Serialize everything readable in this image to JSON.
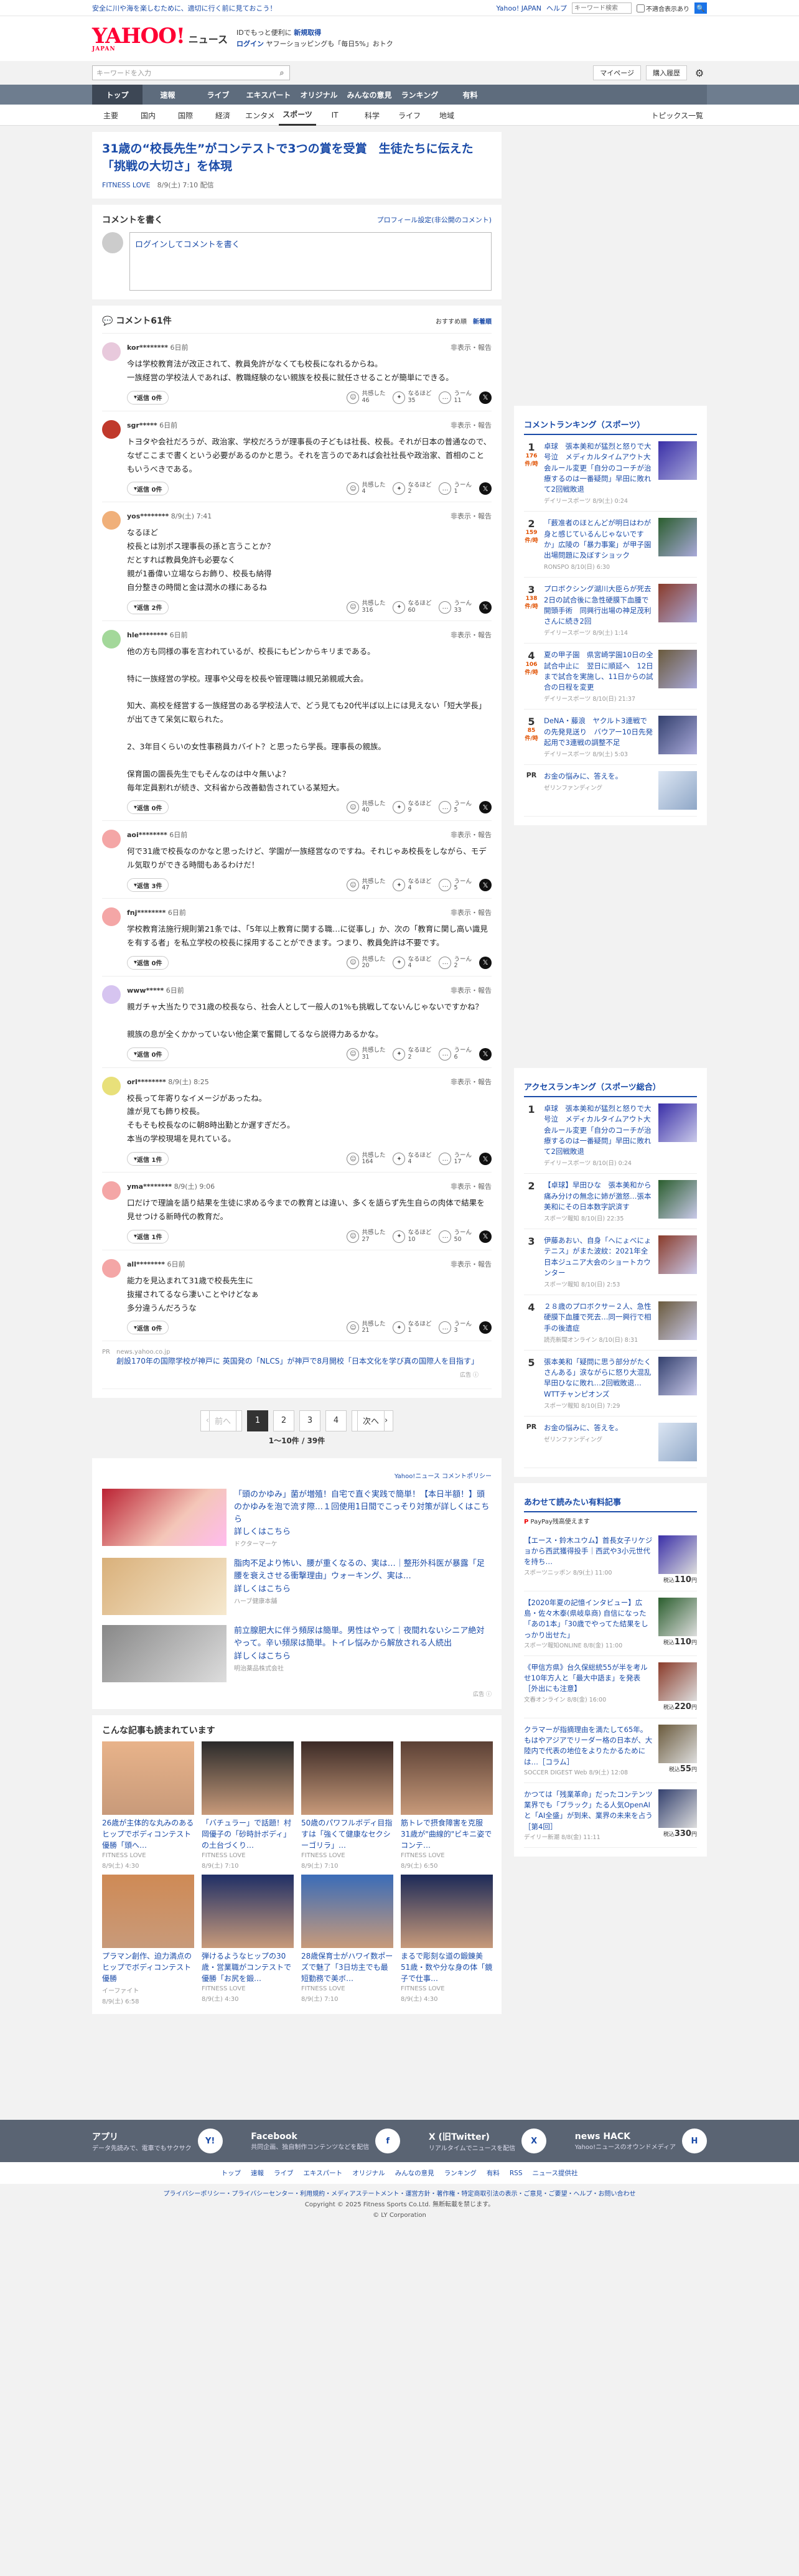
{
  "top": {
    "promo": "安全に川や海を楽しむために、適切に行く前に見ておこう！",
    "links": [
      "Yahoo! JAPAN",
      "ヘルプ"
    ],
    "search_placeholder": "キーワード検索",
    "check_label": "不適合表示あり",
    "search_btn": "🔍"
  },
  "header": {
    "logo": "YAHOO!",
    "logo_sub": "JAPAN",
    "service": "ニュース",
    "promo1": "IDでもっと便利に",
    "promo1b": "新規取得",
    "promo2a": "ログイン",
    "promo2b": "ヤフーショッピングも「毎日5%」おトク"
  },
  "searchrow": {
    "placeholder": "キーワードを入力",
    "mypage": "マイページ",
    "subscribe": "購入履歴"
  },
  "mainnav": [
    "トップ",
    "速報",
    "ライブ",
    "エキスパート",
    "オリジナル",
    "みんなの意見",
    "ランキング",
    "有料"
  ],
  "subnav": [
    "主要",
    "国内",
    "国際",
    "経済",
    "エンタメ",
    "スポーツ",
    "IT",
    "科学",
    "ライフ",
    "地域"
  ],
  "subnav_right": "トピックス一覧",
  "article": {
    "title": "31歳の“校長先生”がコンテストで3つの賞を受賞　生徒たちに伝えた「挑戦の大切さ」を体現",
    "source": "FITNESS LOVE",
    "date": "8/9(土) 7:10 配信"
  },
  "comment_form": {
    "title": "コメントを書く",
    "settings": "プロフィール設定(非公開のコメント)",
    "placeholder": "ログインしてコメントを書く"
  },
  "comments_header": {
    "title": "コメント61件",
    "sort1": "おすすめ順",
    "sort2": "新着順"
  },
  "comments": [
    {
      "user": "kor********",
      "time": "6日前",
      "text": "今は学校教育法が改正されて、教員免許がなくても校長になれるからね。\n一族経営の学校法人であれば、教職経験のない親族を校長に就任させることが簡単にできる。",
      "reply": "返信 0件",
      "c1": "共感した",
      "n1": "46",
      "c2": "なるほど",
      "n2": "35",
      "c3": "うーん",
      "n3": "11",
      "ava": "#e8c9dc"
    },
    {
      "user": "sgr*****",
      "time": "6日前",
      "text": "トヨタや会社だろうが、政治家、学校だろうが理事長の子どもは社長、校長。それが日本の普通なので、なぜここまで書くという必要があるのかと思う。それを言うのであれば会社社長や政治家、首相のこともいうべきである。",
      "reply": "返信 0件",
      "c1": "共感した",
      "n1": "4",
      "c2": "なるほど",
      "n2": "2",
      "c3": "うーん",
      "n3": "1",
      "ava": "#c0392b"
    },
    {
      "user": "yos********",
      "time": "8/9(土) 7:41",
      "text": "なるほど\n校長とは別ポス理事長の孫と言うことか？\nだとすれば教員免許も必要なく\n親が1番偉い立場ならお飾り、校長も納得\n自分整きの時間と金は潤水の様にあるね",
      "reply": "返信 2件",
      "c1": "共感した",
      "n1": "316",
      "c2": "なるほど",
      "n2": "60",
      "c3": "うーん",
      "n3": "33",
      "ava": "#f0b07a"
    },
    {
      "user": "hle********",
      "time": "6日前",
      "text": "他の方も同様の事を言われているが、校長にもピンからキリまである。\n\n特に一族経営の学校。理事や父母を校長や管理職は親兄弟親戚大会。\n\n知大、高校を経営する一族経営のある学校法人で、どう見ても20代半ば以上には見えない「短大学長」が出てきて呆気に取られた。\n\n2、3年目くらいの女性事務員カバイト？と思ったら学長。理事長の親族。\n\n保育園の園長先生でもそんなのは中々無いよ？\n毎年定員割れが続き、文科省から改善勧告されている某短大。",
      "reply": "返信 0件",
      "c1": "共感した",
      "n1": "40",
      "c2": "なるほど",
      "n2": "9",
      "c3": "うーん",
      "n3": "5",
      "ava": "#a3d89a"
    },
    {
      "user": "aoi********",
      "time": "6日前",
      "text": "何で31歳で校長なのかなと思ったけど、学園が一族経営なのですね。それじゃあ校長をしながら、モデル気取りができる時間もあるわけだ！",
      "reply": "返信 3件",
      "c1": "共感した",
      "n1": "47",
      "c2": "なるほど",
      "n2": "4",
      "c3": "うーん",
      "n3": "5",
      "ava": "#f4a6a6"
    },
    {
      "user": "fnj********",
      "time": "6日前",
      "text": "学校教育法施行規則第21条では、「5年以上教育に関する職…に従事し」か、次の「教育に関し高い識見を有する者」を私立学校の校長に採用することができます。つまり、教員免許は不要です。",
      "reply": "返信 0件",
      "c1": "共感した",
      "n1": "20",
      "c2": "なるほど",
      "n2": "4",
      "c3": "うーん",
      "n3": "2",
      "ava": "#f4a6a6"
    },
    {
      "user": "www*****",
      "time": "6日前",
      "text": "親ガチャ大当たりで31歳の校長なら、社会人として一般人の1%も挑戦してないんじゃないですかね？\n\n親族の息が全くかかっていない他企業で奮闘してるなら説得力あるかな。",
      "reply": "返信 0件",
      "c1": "共感した",
      "n1": "31",
      "c2": "なるほど",
      "n2": "2",
      "c3": "うーん",
      "n3": "6",
      "ava": "#d6c4f0"
    },
    {
      "user": "orl********",
      "time": "8/9(土) 8:25",
      "text": "校長って年寄りなイメージがあったね。\n誰が見ても飾り校長。\nそもそも校長なのに朝8時出勤とか遅すぎだろ。\n本当の学校現場を見れている。",
      "reply": "返信 1件",
      "c1": "共感した",
      "n1": "164",
      "c2": "なるほど",
      "n2": "4",
      "c3": "うーん",
      "n3": "17",
      "ava": "#e8e07a"
    },
    {
      "user": "yma********",
      "time": "8/9(土) 9:06",
      "text": "口だけで理論を語り結果を生徒に求める今までの教育とは違い、多くを語らず先生自らの肉体で結果を見せつける新時代の教育だ。",
      "reply": "返信 1件",
      "c1": "共感した",
      "n1": "27",
      "c2": "なるほど",
      "n2": "10",
      "c3": "うーん",
      "n3": "50",
      "ava": "#f4a6a6"
    },
    {
      "user": "all********",
      "time": "6日前",
      "text": "能力を見込まれて31歳で校長先生に\n抜擢されてるなら凄いことやけどなぁ\n多分違うんだろうな",
      "reply": "返信 0件",
      "c1": "共感した",
      "n1": "21",
      "c2": "なるほど",
      "n2": "1",
      "c3": "うーん",
      "n3": "3",
      "ava": "#f4a6a6"
    }
  ],
  "inline_ad": {
    "src": "news.yahoo.co.jp",
    "text": "創設170年の国際学校が神戸に 英国発の「NLCS」が神戸で8月開校「日本文化を学び真の国際人を目指す」",
    "tag": "広告 ⓘ"
  },
  "pager": {
    "prev": "前へ",
    "pages": [
      "1",
      "2",
      "3",
      "4"
    ],
    "next": "次へ",
    "info": "1〜10件 / 39件"
  },
  "brand_line": "Yahoo!ニュース コメントポリシー",
  "ads": [
    {
      "text": "「頭のかゆみ」菌が増殖！自宅で直ぐ実践で簡単！【本日半額！】頭のかゆみを泡で流す際…１回使用1日間でこっそり対策が詳しくはこちら",
      "sponsor": "ドクターマーケ",
      "link": "詳しくはこちら"
    },
    {
      "text": "脂肉不足より怖い、腰が重くなるの、実は…｜整形外科医が暴露「足腰を衰えさせる衝撃理由」ウォーキング、実は…",
      "sponsor": "ハーブ健康本舗",
      "link": "詳しくはこちら"
    },
    {
      "text": "前立腺肥大に伴う頻尿は簡単。男性はやって｜夜間れないシニア絶対やって。辛い頻尿は簡単。トイレ悩みから解放される人続出",
      "sponsor": "明治薬品株式会社",
      "link": "詳しくはこちら"
    }
  ],
  "ad_tag": "広告 ⓘ",
  "related_title": "こんな記事も読まれています",
  "related": [
    {
      "t": "26歳が主体的な丸みのあるヒップでボディコンテスト優勝「頭へ…",
      "s": "FITNESS LOVE",
      "d": "8/9(土) 4:30"
    },
    {
      "t": "「バチュラー」で話題！村岡優子の「砂時計ボディ」の土台づくり…",
      "s": "FITNESS LOVE",
      "d": "8/9(土) 7:10"
    },
    {
      "t": "50歳のパワフルボディ目指すは「強くて健康なセクシーゴリラ」…",
      "s": "FITNESS LOVE",
      "d": "8/9(土) 7:10"
    },
    {
      "t": "筋トレで摂食障害を克服 31歳が\"曲線的\"ビキニ姿でコンテ…",
      "s": "FITNESS LOVE",
      "d": "8/9(土) 6:50"
    },
    {
      "t": "プラマン創作、迫力満点のヒップでボディコンテスト優勝",
      "s": "イーファイト",
      "d": "8/9(土) 6:58"
    },
    {
      "t": "弾けるようなヒップの30歳・営業職がコンテストで優勝「お尻を鍛…",
      "s": "FITNESS LOVE",
      "d": "8/9(土) 4:30"
    },
    {
      "t": "28歳保育士がハワイ数ポーズで魅了「3日坊主でも最短勤務で美ボ…",
      "s": "FITNESS LOVE",
      "d": "8/9(土) 7:10"
    },
    {
      "t": "まるで彫刻な道の鍛錬美 51歳・数や分な身の体「鏡子で仕事…",
      "s": "FITNESS LOVE",
      "d": "8/9(土) 4:30"
    }
  ],
  "side_comment_title": "コメントランキング（スポーツ）",
  "side_comment_rank": [
    {
      "n": "1",
      "c": "176",
      "u": "件/時",
      "t": "卓球　張本美和が猛烈と怒りで大号泣　メディカルタイムアウト大会ルール変更「自分のコーチが治療するのは一番疑問」早田に敗れて2回戦敗退",
      "s": "デイリースポーツ 8/9(土) 0:24"
    },
    {
      "n": "2",
      "c": "159",
      "u": "件/時",
      "t": "「薮准者のほとんどが明日はわが身と感じているんじゃないですか」広陵の「暴力事案」が甲子園出場問題に及ぼすショック",
      "s": "RONSPO 8/10(日) 6:30"
    },
    {
      "n": "3",
      "c": "138",
      "u": "件/時",
      "t": "プロボクシング湖川大臣らが死去　2日の試合後に急性硬膜下血腫で開頭手術　同興行出場の神足茂利さんに続き2回",
      "s": "デイリースポーツ 8/9(土) 1:14"
    },
    {
      "n": "4",
      "c": "106",
      "u": "件/時",
      "t": "夏の甲子園　県宮崎学園10日の全試合中止に　翌日に順延へ　12日まで試合を実施し、11日からの試合の日程を変更",
      "s": "デイリースポーツ 8/10(日) 21:37"
    },
    {
      "n": "5",
      "c": "85",
      "u": "件/時",
      "t": "DeNA・藤浪　ヤクルト3連戦での先発見送り　バウアー10日先発起用で3連戦の調整不足",
      "s": "デイリースポーツ 8/9(土) 5:03"
    }
  ],
  "side_pr": {
    "label": "PR",
    "t": "お金の悩みに、答えを。",
    "s": "ゼリンファンディング"
  },
  "side_access_title": "アクセスランキング（スポーツ総合）",
  "side_access_rank": [
    {
      "n": "1",
      "t": "卓球　張本美和が猛烈と怒りで大号泣　メディカルタイムアウト大会ルール変更「自分のコーチが治療するのは一番疑問」早田に敗れて2回戦敗退",
      "s": "デイリースポーツ 8/10(日) 0:24"
    },
    {
      "n": "2",
      "t": "【卓球】早田ひな　張本美和から痛み分けの無念に姉が激怒…張本美和にその日本数字訳済す",
      "s": "スポーツ報知 8/10(日) 22:35"
    },
    {
      "n": "3",
      "t": "伊藤あおい、自身「へにょべにょテニス」がまた波紋：2021年全日本ジュニア大会のショートカウンター",
      "s": "スポーツ報知 8/10(日) 2:53"
    },
    {
      "n": "4",
      "t": "２８歳のプロボクサー２人、急性硬膜下血腫で死去…同一興行で相手の後遺症",
      "s": "読売新聞オンライン 8/10(日) 8:31"
    },
    {
      "n": "5",
      "t": "張本美和「疑問に思う部分がたくさんある」涙ながらに怒り大混乱　早田ひなに敗れ…2回戦敗退…WTTチャンピオンズ",
      "s": "スポーツ報知 8/10(日) 7:29"
    }
  ],
  "side_shop_title": "あわせて読みたい有料記事",
  "side_shop_sub": "PayPay残高使えます",
  "side_shop": [
    {
      "t": "【エース・鈴木ユウム】首長女子リケジョから西武獲得投手｜西武や3小元世代を持ち…",
      "s": "スポーツニッポン 8/9(土) 11:00",
      "p": "110"
    },
    {
      "t": "【2020年夏の記憶インタビュー】広島・佐々木泰(県岐阜商) 自信になった「あの1本」「30歳でやってた結果をしっかり出せた」",
      "s": "スポーツ報知ONLINE 8/8(金) 11:00",
      "p": "110"
    },
    {
      "t": "《甲信方県》台久保総統55が半を考ルせ10年方人と「最大中語ま」を発表［外出にも注意】",
      "s": "文春オンライン 8/8(金) 16:00",
      "p": "220"
    },
    {
      "t": "クラマーが指摘理由を満たして65年。もはやアジアでリーダー格の日本が、大陸内で代表の地位をよりたかるためには…［コラム］",
      "s": "SOCCER DIGEST Web 8/9(土) 12:08",
      "p": "55"
    },
    {
      "t": "かつては「残業革命」だったコンテンツ業界でも「ブラック」たる人気OpenAIと「AI全盛」が到来、業界の未来を占う［第4回］",
      "s": "デイリー新潮 8/8(金) 11:11",
      "p": "330"
    }
  ],
  "footer": {
    "blocks": [
      {
        "t": "アプリ",
        "d": "データ先読みで、電車でもサクサク",
        "ic": "Y!"
      },
      {
        "t": "Facebook",
        "d": "共同企画、独自制作コンテンツなどを配信",
        "ic": "f"
      },
      {
        "t": "X (旧Twitter)",
        "d": "リアルタイムでニュースを配信",
        "ic": "X"
      },
      {
        "t": "news HACK",
        "d": "Yahoo!ニュースのオウンドメディア",
        "ic": "H"
      }
    ],
    "nav": [
      "トップ",
      "速報",
      "ライブ",
      "エキスパート",
      "オリジナル",
      "みんなの意見",
      "ランキング",
      "有料",
      "RSS",
      "ニュース提供社"
    ],
    "policy": "プライバシーポリシー・プライバシーセンター・利用規約・メディアステートメント・運営方針・著作権・特定商取引法の表示・ご意見・ご要望・ヘルプ・お問い合わせ",
    "copy1": "Copyright © 2025 Fitness Sports Co.Ltd. 無断転載を禁じます。",
    "copy2": "© LY Corporation"
  },
  "colors": {
    "accent": "#1a4ba8",
    "logo": "#ff0033",
    "nav": "#5e6c7d"
  }
}
